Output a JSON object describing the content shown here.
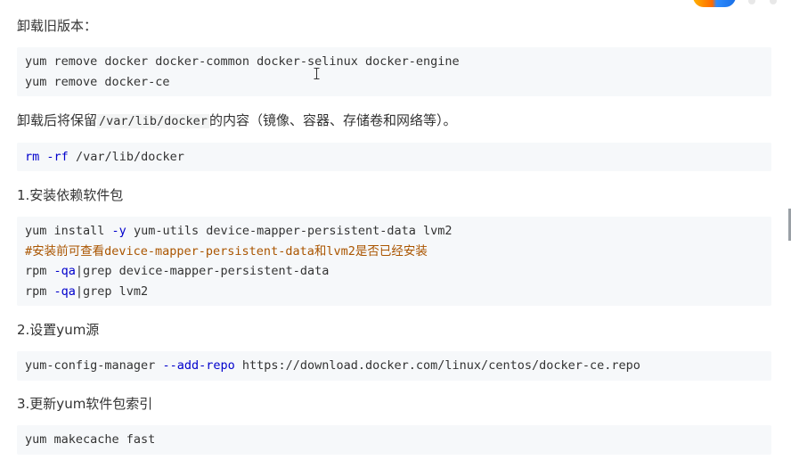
{
  "sections": {
    "uninstall_heading": "卸载旧版本：",
    "uninstall_code": {
      "line1": "yum remove docker docker-common docker-selinux docker-engine",
      "line2": "yum remove docker-ce"
    },
    "keep_note": {
      "prefix": "卸载后将保留",
      "path": "/var/lib/docker",
      "suffix": "的内容（镜像、容器、存储卷和网络等）。"
    },
    "rm_code": {
      "cmd": "rm",
      "opt": "-rf",
      "arg": "/var/lib/docker"
    },
    "step1_heading": "1.安装依赖软件包",
    "step1_code": {
      "l1_cmd": "yum install ",
      "l1_opt": "-y",
      "l1_rest": " yum-utils device-mapper-persistent-data lvm2",
      "l2_comment": "#安装前可查看device-mapper-persistent-data和lvm2是否已经安装",
      "l3_cmd": "rpm ",
      "l3_opt": "-qa",
      "l3_rest": "|grep device-mapper-persistent-data",
      "l4_cmd": "rpm ",
      "l4_opt": "-qa",
      "l4_rest": "|grep lvm2"
    },
    "step2_heading": "2.设置yum源",
    "step2_code": {
      "cmd": "yum-config-manager ",
      "opt": "--add-repo",
      "rest": " https://download.docker.com/linux/centos/docker-ce.repo"
    },
    "step3_heading": "3.更新yum软件包索引",
    "step3_code": {
      "line1": "yum makecache fast"
    }
  },
  "icons": {
    "logo": "brand-logo-icon",
    "cursor": "text-cursor-icon"
  },
  "colors": {
    "code_bg": "#f6f8fa",
    "keyword": "#0000cc",
    "comment": "#aa5500",
    "text": "#333333"
  }
}
